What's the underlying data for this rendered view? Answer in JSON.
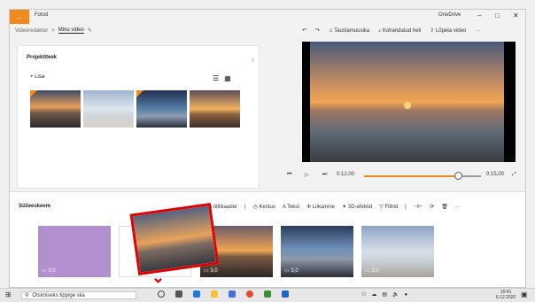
{
  "app": {
    "title": "Fotod",
    "onedrive": "OneDrive"
  },
  "window_controls": {
    "minimize": "–",
    "maximize": "□",
    "close": "✕"
  },
  "breadcrumb": {
    "root": "Videoredaktor",
    "separator": ">",
    "current": "Minu video"
  },
  "toolbar": {
    "undo": "↶",
    "redo": "↷",
    "background_music": "Taustamuusika",
    "custom_audio": "Kohandatud heli",
    "finish_video": "Lõpeta video",
    "more": "···"
  },
  "project_library": {
    "title": "Projektiteek",
    "add_label": "Lisa",
    "list_view": "☰",
    "grid_view": "▦",
    "collapse": "‹"
  },
  "player": {
    "time_current": "0:12,00",
    "time_total": "0:15,00",
    "progress": 0.8
  },
  "storyboard": {
    "title": "Süžeeskeem",
    "tools": [
      "Lisa tiitlikaader",
      "Kestus",
      "Tekst",
      "Liikumine",
      "3D-efektid",
      "Filtrid"
    ],
    "clips": [
      {
        "label": "3,0"
      },
      {
        "label": ""
      },
      {
        "label": "3,0"
      },
      {
        "label": "3,0"
      },
      {
        "label": "3,0"
      }
    ]
  },
  "taskbar": {
    "search_placeholder": "Otsimiseks tippige siia",
    "time": "10:41",
    "date": "6.12.2020"
  },
  "colors": {
    "accent": "#f28a1b",
    "highlight": "#e10000"
  }
}
